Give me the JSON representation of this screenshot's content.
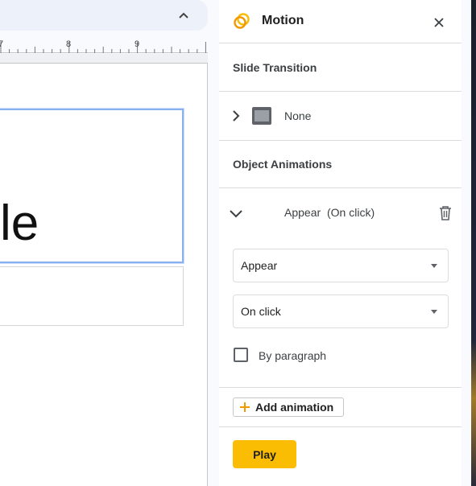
{
  "editor": {
    "ruler_numbers": [
      "7",
      "8",
      "9"
    ],
    "slide_title_fragment": "le"
  },
  "panel": {
    "title": "Motion",
    "icon": "motion-icon",
    "close_icon": "close-icon",
    "slide_transition": {
      "heading": "Slide Transition",
      "value": "None"
    },
    "object_animations": {
      "heading": "Object Animations",
      "animation": {
        "name": "Appear",
        "trigger": "(On click)",
        "effect_select": "Appear",
        "trigger_select": "On click",
        "by_paragraph_label": "By paragraph",
        "by_paragraph_checked": false
      }
    },
    "add_animation_label": "Add animation",
    "play_label": "Play"
  },
  "colors": {
    "accent": "#fbbc04",
    "selection_border": "#8ab0f0"
  }
}
